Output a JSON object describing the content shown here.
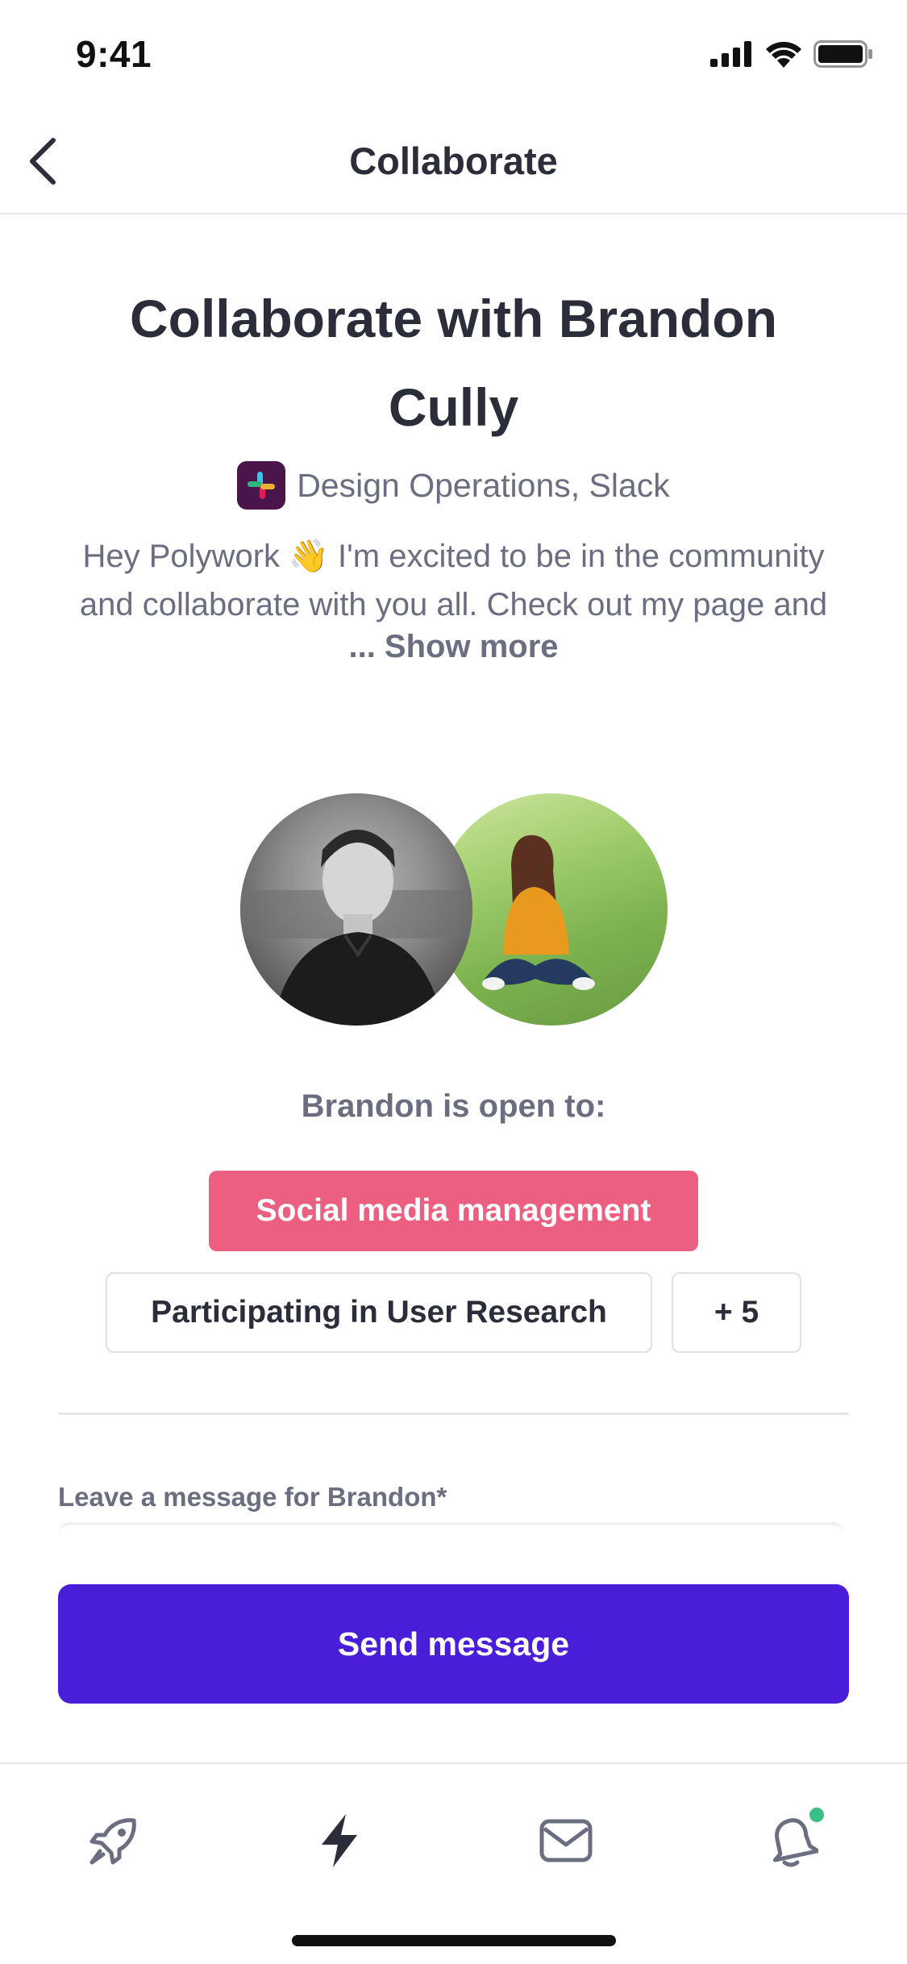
{
  "status_bar": {
    "time": "9:41"
  },
  "header": {
    "title": "Collaborate"
  },
  "profile": {
    "title": "Collaborate with Brandon Cully",
    "company": "Design Operations, Slack",
    "bio": "Hey Polywork 👋 I'm excited to be in the community and collaborate with you all. Check out my page and",
    "show_more": "... Show more"
  },
  "open_to": {
    "title": "Brandon is open to:",
    "chips": [
      "Social media management",
      "Participating in User Research"
    ],
    "more": "+ 5"
  },
  "message": {
    "label": "Leave a message for Brandon*",
    "send_label": "Send message"
  },
  "tab_bar": {
    "icons": [
      "rocket-icon",
      "lightning-icon",
      "mail-icon",
      "bell-icon"
    ],
    "notification_color": "#3cbf85"
  },
  "colors": {
    "accent": "#4a1ed8",
    "chip_primary": "#ec5f81",
    "text_dark": "#2b2d3a",
    "text_muted": "#6b6e80"
  }
}
